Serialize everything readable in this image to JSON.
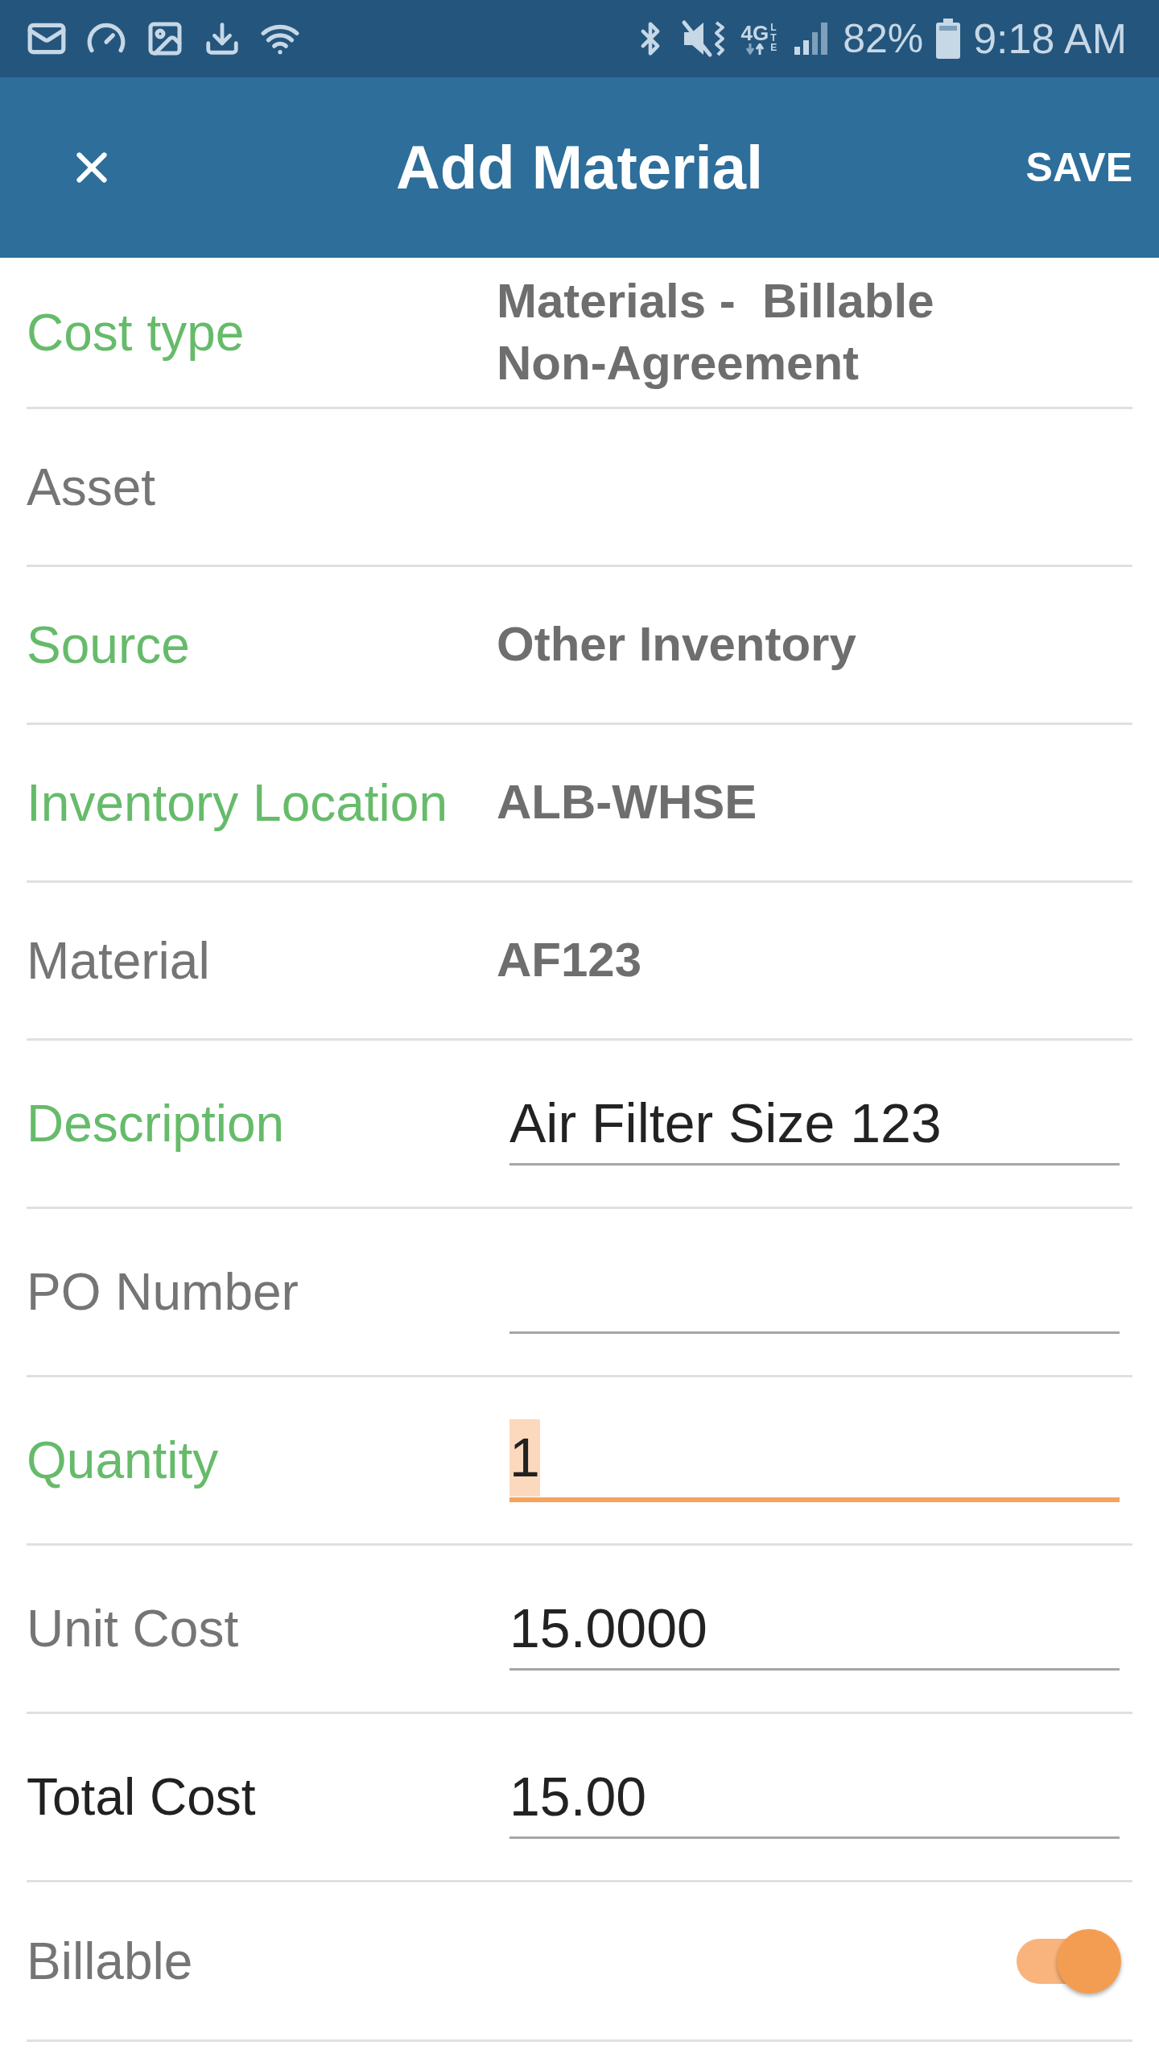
{
  "status_bar": {
    "network": "4G",
    "network_sub": "LTE",
    "battery": "82%",
    "time": "9:18 AM"
  },
  "header": {
    "title": "Add Material",
    "action": "SAVE"
  },
  "rows": [
    {
      "kind": "value",
      "label": "Cost type",
      "color": "#66bb6a",
      "value": "Materials -  Billable Non-Agreement"
    },
    {
      "kind": "value",
      "label": "Asset",
      "color": "#757575"
    },
    {
      "kind": "value",
      "label": "Source",
      "color": "#66bb6a",
      "value": "Other Inventory"
    },
    {
      "kind": "value",
      "label": "Inventory Location",
      "color": "#66bb6a",
      "value": "ALB-WHSE"
    },
    {
      "kind": "value",
      "label": "Material",
      "color": "#757575",
      "value": "AF123"
    },
    {
      "kind": "input",
      "label": "Description",
      "color": "#66bb6a",
      "value": "Air Filter Size 123",
      "focused": false
    },
    {
      "kind": "input",
      "label": "PO Number",
      "color": "#757575",
      "focused": false
    },
    {
      "kind": "input",
      "label": "Quantity",
      "color": "#66bb6a",
      "value": "1",
      "focused": true
    },
    {
      "kind": "input",
      "label": "Unit Cost",
      "color": "#757575",
      "value": "15.0000",
      "focused": false
    },
    {
      "kind": "input",
      "label": "Total Cost",
      "color": "#212121",
      "value": "15.00",
      "focused": false
    },
    {
      "kind": "toggle",
      "label": "Billable",
      "color": "#757575",
      "on": true
    }
  ]
}
